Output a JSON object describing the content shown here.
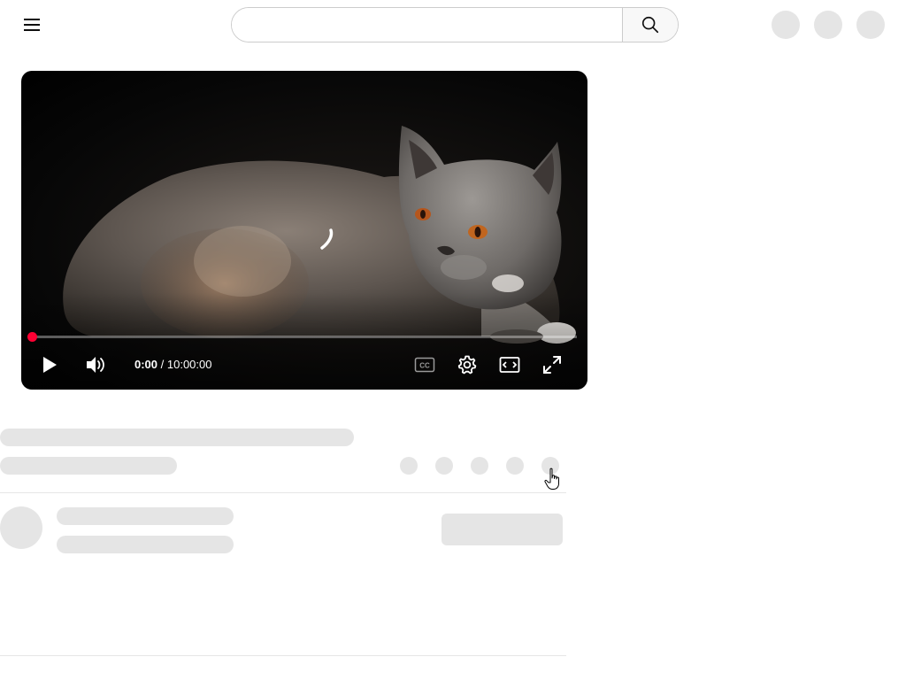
{
  "header": {
    "menu_icon": "hamburger-menu-icon",
    "search": {
      "placeholder": "",
      "value": "",
      "button_icon": "search-icon"
    },
    "right_placeholders": 3
  },
  "player": {
    "current_time": "0:00",
    "separator": " / ",
    "duration": "10:00:00",
    "progress": 0,
    "controls": {
      "play_icon": "play-icon",
      "volume_icon": "volume-icon",
      "captions_icon": "cc-icon",
      "settings_icon": "gear-icon",
      "theater_icon": "theater-mode-icon",
      "fullscreen_icon": "fullscreen-icon"
    },
    "loading_icon": "loading-spinner-icon"
  },
  "colors": {
    "accent": "#ff0033",
    "skeleton": "#e5e5e5",
    "background": "#ffffff",
    "text_dark": "#0f0f0f"
  }
}
